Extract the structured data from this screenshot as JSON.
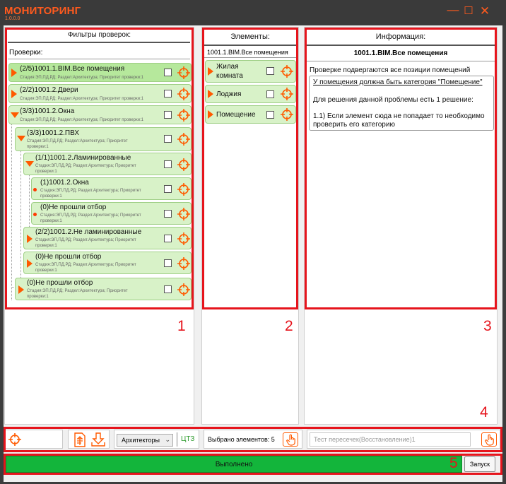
{
  "app": {
    "title": "МОНИТОРИНГ",
    "version": "1.0.0.0"
  },
  "window_controls": {
    "minimize": "—",
    "maximize": "☐",
    "close": "✕"
  },
  "filters_panel": {
    "header": "Фильтры проверок:",
    "checks_label": "Проверки:",
    "nodes": [
      {
        "title": "(2/5)1001.1.BIM.Все помещения",
        "sub": "Стадия:ЭП,ПД,РД; Раздел:Архитектура; Приоритет проверки:1"
      },
      {
        "title": "(2/2)1001.2.Двери",
        "sub": "Стадия:ЭП,ПД,РД; Раздел:Архитектура; Приоритет проверки:1"
      },
      {
        "title": "(3/3)1001.2.Окна",
        "sub": "Стадия:ЭП,ПД,РД; Раздел:Архитектура; Приоритет проверки:1"
      },
      {
        "title": "(3/3)1001.2.ПВХ",
        "sub1": "Стадия:ЭП,ПД,РД; Раздел:Архитектура; Приоритет",
        "sub2": "проверки:1"
      },
      {
        "title": "(1/1)1001.2.Ламинированные",
        "sub1": "Стадия:ЭП,ПД,РД; Раздел:Архитектура; Приоритет",
        "sub2": "проверки:1"
      },
      {
        "title": "(1)1001.2.Окна",
        "sub1": "Стадия:ЭП,ПД,РД; Раздел:Архитектура; Приоритет",
        "sub2": "проверки:1"
      },
      {
        "title": "(0)Не прошли отбор",
        "sub1": "Стадия:ЭП,ПД,РД; Раздел:Архитектура; Приоритет",
        "sub2": "проверки:1"
      },
      {
        "title": "(2/2)1001.2.Не ламинированные",
        "sub1": "Стадия:ЭП,ПД,РД; Раздел:Архитектура; Приоритет",
        "sub2": "проверки:1"
      },
      {
        "title": "(0)Не прошли отбор",
        "sub1": "Стадия:ЭП,ПД,РД; Раздел:Архитектура; Приоритет",
        "sub2": "проверки:1"
      },
      {
        "title": "(0)Не прошли отбор",
        "sub1": "Стадия:ЭП,ПД,РД; Раздел:Архитектура; Приоритет",
        "sub2": "проверки:1"
      }
    ]
  },
  "elements_panel": {
    "header": "Элементы:",
    "subheader": "1001.1.BIM.Все помещения",
    "items": [
      {
        "line1": "Жилая",
        "line2": "комната"
      },
      {
        "line1": "Лоджия"
      },
      {
        "line1": "Помещение"
      }
    ]
  },
  "info_panel": {
    "header": "Информация:",
    "title": "1001.1.BIM.Все помещения",
    "description": "Проверке подвергаются все позиции помещений",
    "message_heading": "У помещения должна быть категория \"Помещение\"",
    "message_line1": "Для решения данной проблемы есть 1 решение:",
    "message_line2": "1.1) Если элемент сюда не попадает то необходимо",
    "message_line3": "проверить его категорию"
  },
  "annotations": {
    "n1": "1",
    "n2": "2",
    "n3": "3",
    "n4": "4",
    "n5": "5"
  },
  "toolbar": {
    "discipline_select": "Архитекторы",
    "discipline_code": "ЦТЗ",
    "selected_label": "Выбрано элементов: 5",
    "collision_placeholder": "Тест пересечек(Восстановление)1"
  },
  "status": {
    "progress_percent": 100,
    "progress_label": "Выполнено",
    "run_button": "Запуск"
  },
  "colors": {
    "accent": "#ff5a00",
    "highlight": "#e6141c",
    "node_bg": "#d8f2c8",
    "progress": "#13b53b"
  },
  "icons": [
    "crosshair-icon",
    "expand-arrow-icon",
    "collapse-arrow-icon",
    "export-doc-icon",
    "download-arrow-icon",
    "hand-pointer-icon",
    "chevron-down-icon"
  ]
}
